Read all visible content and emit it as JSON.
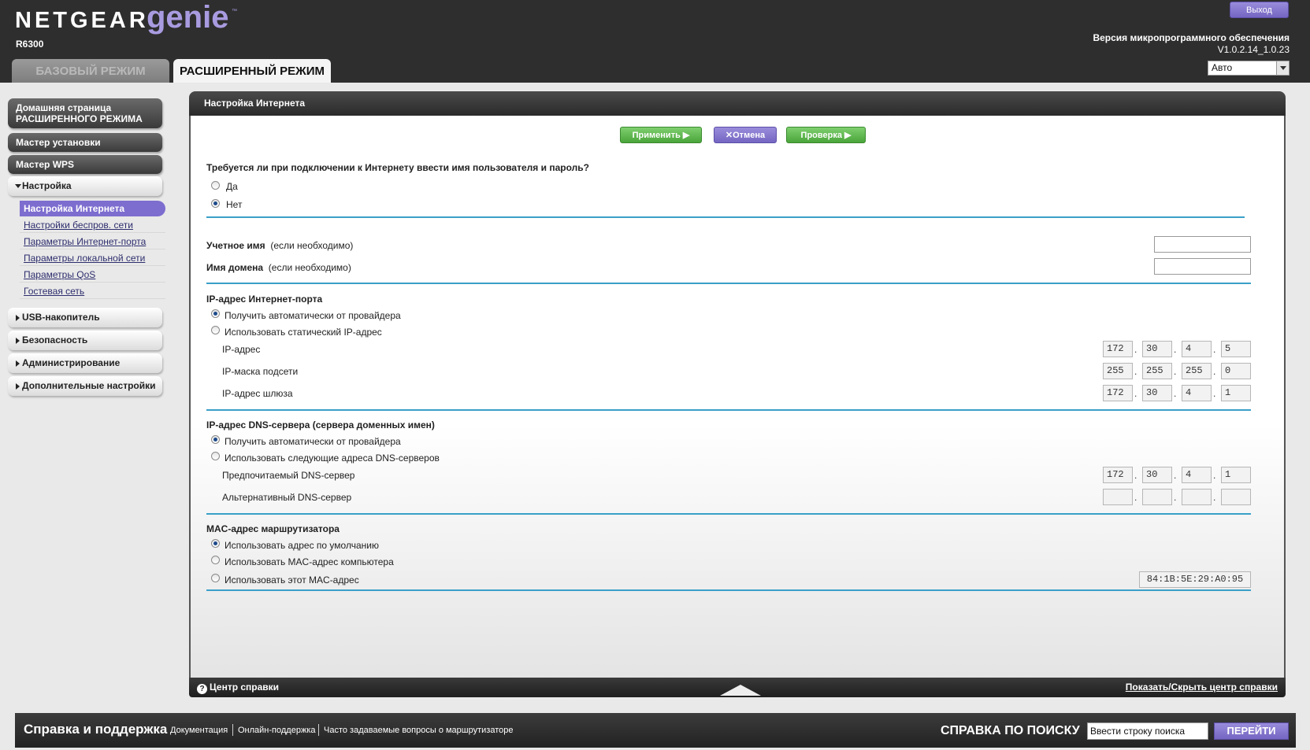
{
  "header": {
    "brand": "NETGEAR",
    "product": "genie",
    "trademark": "™",
    "model": "R6300",
    "tabs": {
      "basic": "БАЗОВЫЙ РЕЖИМ",
      "advanced": "РАСШИРЕННЫЙ РЕЖИМ"
    },
    "logout": "Выход",
    "firmware_label": "Версия микропрограммного обеспечения",
    "firmware_version": "V1.0.2.14_1.0.23",
    "language": "Авто"
  },
  "sidebar": {
    "home_line1": "Домашняя страница",
    "home_line2": "РАСШИРЕННОГО РЕЖИМА",
    "setup_wizard": "Мастер установки",
    "wps_wizard": "Мастер WPS",
    "setup": "Настройка",
    "sub_items": [
      "Настройка Интернета",
      "Настройки беспров. сети",
      "Параметры Интернет-порта",
      "Параметры локальной сети",
      "Параметры QoS",
      "Гостевая сеть"
    ],
    "usb": "USB-накопитель",
    "security": "Безопасность",
    "admin": "Администрирование",
    "advanced": "Дополнительные настройки"
  },
  "main": {
    "title": "Настройка Интернета",
    "buttons": {
      "apply": "Применить ▶",
      "cancel": "Отмена",
      "test": "Проверка ▶"
    },
    "login_question": "Требуется ли при подключении к Интернету ввести имя пользователя и пароль?",
    "yes": "Да",
    "no": "Нет",
    "account_name": "Учетное имя",
    "domain_name": "Имя домена",
    "if_required": "(если необходимо)",
    "ip_section": "IP-адрес Интернет-порта",
    "ip_auto": "Получить автоматически от провайдера",
    "ip_static": "Использовать статический IP-адрес",
    "ip_address_label": "IP-адрес",
    "subnet_label": "IP-маска подсети",
    "gateway_label": "IP-адрес шлюза",
    "ip_address": [
      "172",
      "30",
      "4",
      "5"
    ],
    "subnet": [
      "255",
      "255",
      "255",
      "0"
    ],
    "gateway": [
      "172",
      "30",
      "4",
      "1"
    ],
    "dns_section": "IP-адрес DNS-сервера (сервера доменных имен)",
    "dns_auto": "Получить автоматически от провайдера",
    "dns_manual": "Использовать следующие адреса DNS-серверов",
    "primary_dns_label": "Предпочитаемый DNS-сервер",
    "secondary_dns_label": "Альтернативный DNS-сервер",
    "primary_dns": [
      "172",
      "30",
      "4",
      "1"
    ],
    "secondary_dns": [
      "",
      "",
      "",
      ""
    ],
    "mac_section": "MAC-адрес маршрутизатора",
    "mac_default": "Использовать адрес по умолчанию",
    "mac_computer": "Использовать MAC-адрес компьютера",
    "mac_this": "Использовать этот MAC-адрес",
    "mac_value": "84:1B:5E:29:A0:95",
    "help_center": "Центр справки",
    "help_toggle": "Показать/Скрыть центр справки"
  },
  "support": {
    "title": "Справка и поддержка",
    "links": [
      "Документация",
      "Онлайн-поддержка",
      "Часто задаваемые вопросы о маршрутизаторе"
    ],
    "search_label": "СПРАВКА ПО ПОИСКУ",
    "search_value": "Ввести строку поиска",
    "go": "ПЕРЕЙТИ"
  },
  "colors": {
    "accent_purple": "#7c6dcf",
    "apply_green": "#4aa53a",
    "divider_blue": "#3aa0c8",
    "header_dark": "#2e2e2e"
  }
}
